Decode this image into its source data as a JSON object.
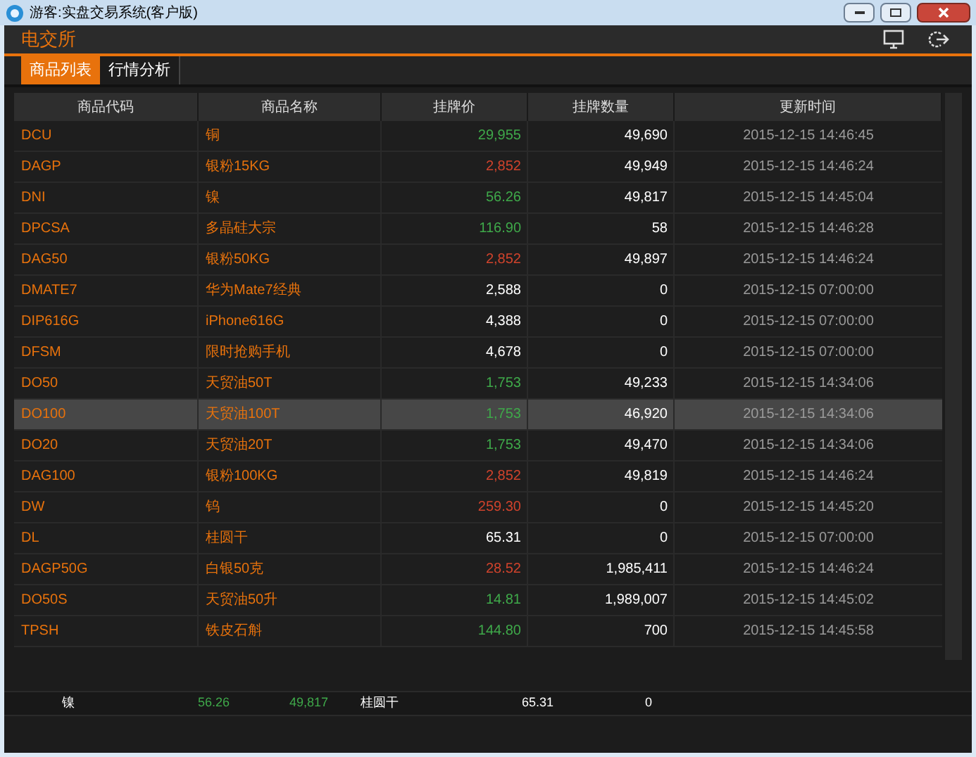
{
  "window": {
    "title": "游客:实盘交易系统(客户版)"
  },
  "header": {
    "title": "电交所"
  },
  "tabs": [
    {
      "label": "商品列表",
      "selected": true
    },
    {
      "label": "行情分析",
      "selected": false
    }
  ],
  "table": {
    "columns": [
      "商品代码",
      "商品名称",
      "挂牌价",
      "挂牌数量",
      "更新时间"
    ],
    "rows": [
      {
        "code": "DCU",
        "name": "铜",
        "price": "29,955",
        "color": "#3fa94a",
        "qty": "49,690",
        "time": "2015-12-15 14:46:45",
        "selected": false
      },
      {
        "code": "DAGP",
        "name": "银粉15KG",
        "price": "2,852",
        "color": "#d0432c",
        "qty": "49,949",
        "time": "2015-12-15 14:46:24",
        "selected": false
      },
      {
        "code": "DNI",
        "name": "镍",
        "price": "56.26",
        "color": "#3fa94a",
        "qty": "49,817",
        "time": "2015-12-15 14:45:04",
        "selected": false
      },
      {
        "code": "DPCSA",
        "name": "多晶硅大宗",
        "price": "116.90",
        "color": "#3fa94a",
        "qty": "58",
        "time": "2015-12-15 14:46:28",
        "selected": false
      },
      {
        "code": "DAG50",
        "name": "银粉50KG",
        "price": "2,852",
        "color": "#d0432c",
        "qty": "49,897",
        "time": "2015-12-15 14:46:24",
        "selected": false
      },
      {
        "code": "DMATE7",
        "name": "华为Mate7经典",
        "price": "2,588",
        "color": "#ffffff",
        "qty": "0",
        "time": "2015-12-15 07:00:00",
        "selected": false
      },
      {
        "code": "DIP616G",
        "name": "iPhone616G",
        "price": "4,388",
        "color": "#ffffff",
        "qty": "0",
        "time": "2015-12-15 07:00:00",
        "selected": false
      },
      {
        "code": "DFSM",
        "name": "限时抢购手机",
        "price": "4,678",
        "color": "#ffffff",
        "qty": "0",
        "time": "2015-12-15 07:00:00",
        "selected": false
      },
      {
        "code": "DO50",
        "name": "天贸油50T",
        "price": "1,753",
        "color": "#3fa94a",
        "qty": "49,233",
        "time": "2015-12-15 14:34:06",
        "selected": false
      },
      {
        "code": "DO100",
        "name": "天贸油100T",
        "price": "1,753",
        "color": "#3fa94a",
        "qty": "46,920",
        "time": "2015-12-15 14:34:06",
        "selected": true
      },
      {
        "code": "DO20",
        "name": "天贸油20T",
        "price": "1,753",
        "color": "#3fa94a",
        "qty": "49,470",
        "time": "2015-12-15 14:34:06",
        "selected": false
      },
      {
        "code": "DAG100",
        "name": "银粉100KG",
        "price": "2,852",
        "color": "#d0432c",
        "qty": "49,819",
        "time": "2015-12-15 14:46:24",
        "selected": false
      },
      {
        "code": "DW",
        "name": "钨",
        "price": "259.30",
        "color": "#d0432c",
        "qty": "0",
        "time": "2015-12-15 14:45:20",
        "selected": false
      },
      {
        "code": "DL",
        "name": "桂圆干",
        "price": "65.31",
        "color": "#ffffff",
        "qty": "0",
        "time": "2015-12-15 07:00:00",
        "selected": false
      },
      {
        "code": "DAGP50G",
        "name": "白银50克",
        "price": "28.52",
        "color": "#d0432c",
        "qty": "1,985,411",
        "time": "2015-12-15 14:46:24",
        "selected": false
      },
      {
        "code": "DO50S",
        "name": "天贸油50升",
        "price": "14.81",
        "color": "#3fa94a",
        "qty": "1,989,007",
        "time": "2015-12-15 14:45:02",
        "selected": false
      },
      {
        "code": "TPSH",
        "name": "铁皮石斛",
        "price": "144.80",
        "color": "#3fa94a",
        "qty": "700",
        "time": "2015-12-15 14:45:58",
        "selected": false
      }
    ]
  },
  "ticker": [
    {
      "name": "镍",
      "price": "56.26",
      "qty": "49,817",
      "color": "#3fa94a"
    },
    {
      "name": "桂圆干",
      "price": "65.31",
      "qty": "0",
      "color": "#ffffff"
    }
  ]
}
